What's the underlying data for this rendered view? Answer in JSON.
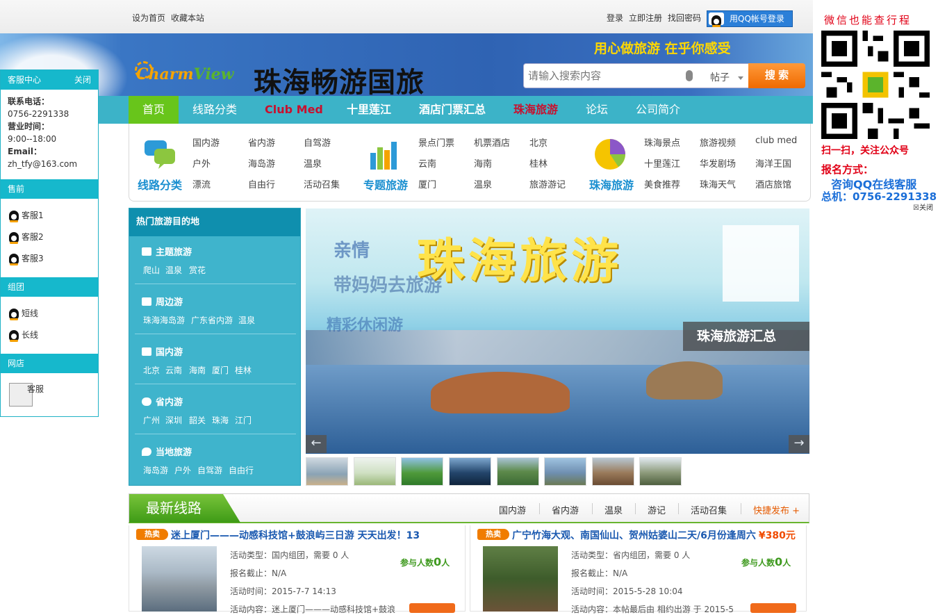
{
  "topbar": {
    "set_home": "设为首页",
    "bookmark": "收藏本站",
    "login": "登录",
    "register": "立即注册",
    "find_password": "找回密码",
    "qq_login": "用QQ帐号登录"
  },
  "header": {
    "logo_en_a": "Charm",
    "logo_en_b": "View",
    "logo_cn": "珠海畅游国旅",
    "slogan": "用心做旅游  在乎你感受",
    "search_placeholder": "请输入搜索内容",
    "search_scope": "帖子",
    "search_button": "搜 索"
  },
  "nav": {
    "items": [
      "首页",
      "线路分类",
      "Club Med",
      "十里莲江",
      "酒店门票汇总",
      "珠海旅游",
      "论坛",
      "公司简介"
    ]
  },
  "megamenu": {
    "group1": {
      "title": "线路分类",
      "links": [
        "国内游",
        "省内游",
        "自驾游",
        "户外",
        "海岛游",
        "温泉",
        "漂流",
        "自由行",
        "活动召集"
      ]
    },
    "group2": {
      "title": "专题旅游",
      "links": [
        "景点门票",
        "机票酒店",
        "北京",
        "云南",
        "海南",
        "桂林",
        "厦门",
        "温泉",
        "旅游游记"
      ]
    },
    "group3": {
      "title": "珠海旅游",
      "links": [
        "珠海景点",
        "旅游视频",
        "club med",
        "十里莲江",
        "华发剧场",
        "海洋王国",
        "美食推荐",
        "珠海天气",
        "酒店旅馆"
      ]
    }
  },
  "sidebar": {
    "title": "客服中心",
    "close": "关闭",
    "phone_label": "联系电话：",
    "phone": "0756-2291338",
    "hours_label": "营业时间：",
    "hours": "9:00--18:00",
    "email_label": "Email：",
    "email": "zh_tfy@163.com",
    "presale": "售前",
    "presale_items": [
      "客服1",
      "客服2",
      "客服3"
    ],
    "group": "组团",
    "group_items": [
      "短线",
      "长线"
    ],
    "shop": "网店",
    "shop_item": "客服"
  },
  "qr_panel": {
    "title": "微信也能查行程",
    "scan": "扫一扫，关注公众号",
    "signup": "报名方式：",
    "qq": "咨询QQ在线客服",
    "tel": "总机：0756-2291338",
    "close": "关闭"
  },
  "hot": {
    "title": "热门旅游目的地",
    "sections": [
      {
        "title": "主题旅游",
        "links": [
          "爬山",
          "温泉",
          "赏花"
        ]
      },
      {
        "title": "周边游",
        "links": [
          "珠海海岛游",
          "广东省内游",
          "温泉"
        ]
      },
      {
        "title": "国内游",
        "links": [
          "北京",
          "云南",
          "海南",
          "厦门",
          "桂林"
        ]
      },
      {
        "title": "省内游",
        "links": [
          "广州",
          "深圳",
          "韶关",
          "珠海",
          "江门"
        ]
      },
      {
        "title": "当地旅游",
        "links": [
          "海岛游",
          "户外",
          "自驾游",
          "自由行"
        ]
      }
    ]
  },
  "banner": {
    "title": "珠海旅游",
    "overlay1": "亲情",
    "overlay2": "带妈妈去旅游",
    "overlay3": "精彩休闲游",
    "caption": "珠海旅游汇总",
    "prev": "←",
    "next": "→"
  },
  "latest": {
    "title": "最新线路",
    "tabs": [
      "国内游",
      "省内游",
      "温泉",
      "游记",
      "活动召集"
    ],
    "post": "快捷发布 +"
  },
  "cards": [
    {
      "badge": "热卖",
      "title": "迷上厦门———动感科技馆+鼓浪屿三日游 天天出发！13",
      "price": "",
      "type": "活动类型：国内组团，需要 0 人",
      "deadline": "报名截止：N/A",
      "time": "活动时间：2015-7-7 14:13",
      "content": "活动内容：迷上厦门———动感科技馆+鼓浪",
      "count_label": "参与人数",
      "count": "0",
      "count_unit": "人"
    },
    {
      "badge": "热卖",
      "title": "广宁竹海大观、南国仙山、贺州姑婆山二天/6月份逢周六",
      "price": "¥380元",
      "type": "活动类型：省内组团，需要 0 人",
      "deadline": "报名截止：N/A",
      "time": "活动时间：2015-5-28 10:04",
      "content": "活动内容：本帖最后由 相约出游 于 2015-5",
      "count_label": "参与人数",
      "count": "0",
      "count_unit": "人"
    }
  ],
  "colors": {
    "nav_bg": "#3cb3c8",
    "nav_active": "#68c51b",
    "accent_red": "#c8102e",
    "search_orange": "#ef6a00"
  }
}
